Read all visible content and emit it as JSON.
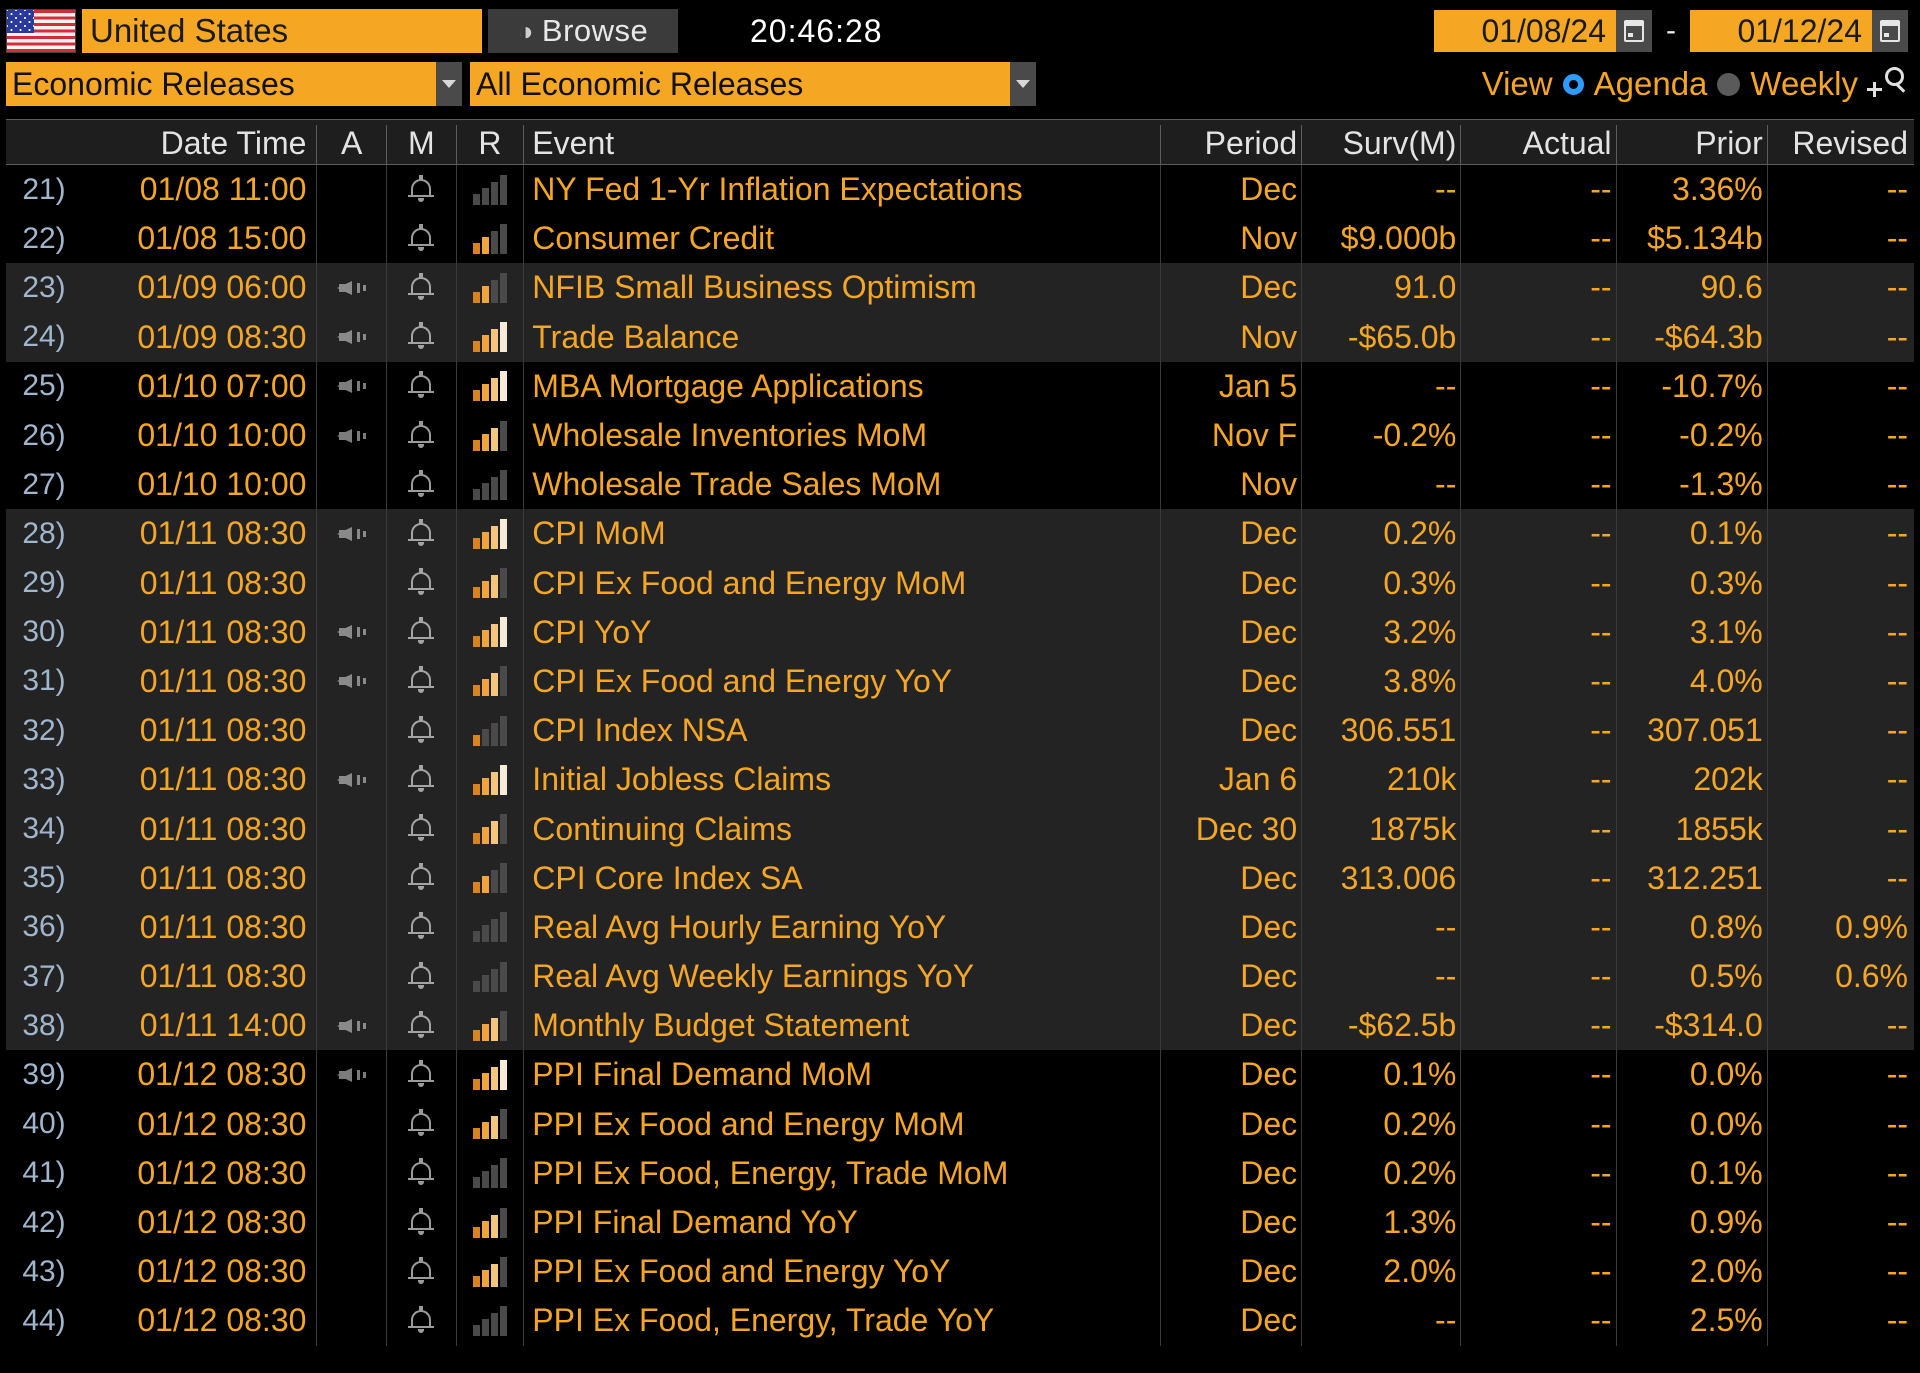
{
  "header": {
    "flag_icon": "us-flag-icon",
    "ticker_value": "United States",
    "browse_label": "Browse",
    "browse_glyph": "◑",
    "clock": "20:46:28",
    "date_from": "01/08/24",
    "date_to": "01/12/24",
    "date_sep": "-",
    "calendar_icon": "calendar-icon",
    "category_value": "Economic Releases",
    "subcategory_value": "All Economic Releases",
    "view_label": "View",
    "view_options": [
      "Agenda",
      "Weekly"
    ],
    "view_selected": "Agenda",
    "search_icon": "add-search-icon",
    "accent_orange": "#f5a623",
    "accent_blue": "#2e9bff"
  },
  "table": {
    "columns": [
      "Date Time",
      "A",
      "M",
      "R",
      "Event",
      "Period",
      "Surv(M)",
      "Actual",
      "Prior",
      "Revised"
    ],
    "rows": [
      {
        "num": "21)",
        "date": "01/08 11:00",
        "audio": false,
        "alert": true,
        "relevance": 0,
        "event": "NY Fed 1-Yr Inflation Expectations",
        "period": "Dec",
        "surv": "--",
        "actual": "--",
        "prior": "3.36%",
        "revised": "--",
        "group": 0
      },
      {
        "num": "22)",
        "date": "01/08 15:00",
        "audio": false,
        "alert": true,
        "relevance": 2,
        "event": "Consumer Credit",
        "period": "Nov",
        "surv": "$9.000b",
        "actual": "--",
        "prior": "$5.134b",
        "revised": "--",
        "group": 0
      },
      {
        "num": "23)",
        "date": "01/09 06:00",
        "audio": true,
        "alert": true,
        "relevance": 2,
        "event": "NFIB Small Business Optimism",
        "period": "Dec",
        "surv": "91.0",
        "actual": "--",
        "prior": "90.6",
        "revised": "--",
        "group": 1
      },
      {
        "num": "24)",
        "date": "01/09 08:30",
        "audio": true,
        "alert": true,
        "relevance": 4,
        "event": "Trade Balance",
        "period": "Nov",
        "surv": "-$65.0b",
        "actual": "--",
        "prior": "-$64.3b",
        "revised": "--",
        "group": 1
      },
      {
        "num": "25)",
        "date": "01/10 07:00",
        "audio": true,
        "alert": true,
        "relevance": 4,
        "event": "MBA Mortgage Applications",
        "period": "Jan 5",
        "surv": "--",
        "actual": "--",
        "prior": "-10.7%",
        "revised": "--",
        "group": 2
      },
      {
        "num": "26)",
        "date": "01/10 10:00",
        "audio": true,
        "alert": true,
        "relevance": 3,
        "event": "Wholesale Inventories MoM",
        "period": "Nov F",
        "surv": "-0.2%",
        "actual": "--",
        "prior": "-0.2%",
        "revised": "--",
        "group": 2
      },
      {
        "num": "27)",
        "date": "01/10 10:00",
        "audio": false,
        "alert": true,
        "relevance": 0,
        "event": "Wholesale Trade Sales MoM",
        "period": "Nov",
        "surv": "--",
        "actual": "--",
        "prior": "-1.3%",
        "revised": "--",
        "group": 2
      },
      {
        "num": "28)",
        "date": "01/11 08:30",
        "audio": true,
        "alert": true,
        "relevance": 4,
        "event": "CPI MoM",
        "period": "Dec",
        "surv": "0.2%",
        "actual": "--",
        "prior": "0.1%",
        "revised": "--",
        "group": 3
      },
      {
        "num": "29)",
        "date": "01/11 08:30",
        "audio": false,
        "alert": true,
        "relevance": 3,
        "event": "CPI Ex Food and Energy MoM",
        "period": "Dec",
        "surv": "0.3%",
        "actual": "--",
        "prior": "0.3%",
        "revised": "--",
        "group": 3
      },
      {
        "num": "30)",
        "date": "01/11 08:30",
        "audio": true,
        "alert": true,
        "relevance": 4,
        "event": "CPI YoY",
        "period": "Dec",
        "surv": "3.2%",
        "actual": "--",
        "prior": "3.1%",
        "revised": "--",
        "group": 3
      },
      {
        "num": "31)",
        "date": "01/11 08:30",
        "audio": true,
        "alert": true,
        "relevance": 3,
        "event": "CPI Ex Food and Energy YoY",
        "period": "Dec",
        "surv": "3.8%",
        "actual": "--",
        "prior": "4.0%",
        "revised": "--",
        "group": 3
      },
      {
        "num": "32)",
        "date": "01/11 08:30",
        "audio": false,
        "alert": true,
        "relevance": 1,
        "event": "CPI Index NSA",
        "period": "Dec",
        "surv": "306.551",
        "actual": "--",
        "prior": "307.051",
        "revised": "--",
        "group": 3
      },
      {
        "num": "33)",
        "date": "01/11 08:30",
        "audio": true,
        "alert": true,
        "relevance": 4,
        "event": "Initial Jobless Claims",
        "period": "Jan 6",
        "surv": "210k",
        "actual": "--",
        "prior": "202k",
        "revised": "--",
        "group": 3
      },
      {
        "num": "34)",
        "date": "01/11 08:30",
        "audio": false,
        "alert": true,
        "relevance": 3,
        "event": "Continuing Claims",
        "period": "Dec 30",
        "surv": "1875k",
        "actual": "--",
        "prior": "1855k",
        "revised": "--",
        "group": 3
      },
      {
        "num": "35)",
        "date": "01/11 08:30",
        "audio": false,
        "alert": true,
        "relevance": 2,
        "event": "CPI Core Index SA",
        "period": "Dec",
        "surv": "313.006",
        "actual": "--",
        "prior": "312.251",
        "revised": "--",
        "group": 3
      },
      {
        "num": "36)",
        "date": "01/11 08:30",
        "audio": false,
        "alert": true,
        "relevance": 0,
        "event": "Real Avg Hourly Earning YoY",
        "period": "Dec",
        "surv": "--",
        "actual": "--",
        "prior": "0.8%",
        "revised": "0.9%",
        "group": 3
      },
      {
        "num": "37)",
        "date": "01/11 08:30",
        "audio": false,
        "alert": true,
        "relevance": 0,
        "event": "Real Avg Weekly Earnings YoY",
        "period": "Dec",
        "surv": "--",
        "actual": "--",
        "prior": "0.5%",
        "revised": "0.6%",
        "group": 3
      },
      {
        "num": "38)",
        "date": "01/11 14:00",
        "audio": true,
        "alert": true,
        "relevance": 3,
        "event": "Monthly Budget Statement",
        "period": "Dec",
        "surv": "-$62.5b",
        "actual": "--",
        "prior": "-$314.0",
        "revised": "--",
        "group": 3
      },
      {
        "num": "39)",
        "date": "01/12 08:30",
        "audio": true,
        "alert": true,
        "relevance": 4,
        "event": "PPI Final Demand MoM",
        "period": "Dec",
        "surv": "0.1%",
        "actual": "--",
        "prior": "0.0%",
        "revised": "--",
        "group": 4
      },
      {
        "num": "40)",
        "date": "01/12 08:30",
        "audio": false,
        "alert": true,
        "relevance": 3,
        "event": "PPI Ex Food and Energy MoM",
        "period": "Dec",
        "surv": "0.2%",
        "actual": "--",
        "prior": "0.0%",
        "revised": "--",
        "group": 4
      },
      {
        "num": "41)",
        "date": "01/12 08:30",
        "audio": false,
        "alert": true,
        "relevance": 0,
        "event": "PPI Ex Food, Energy, Trade MoM",
        "period": "Dec",
        "surv": "0.2%",
        "actual": "--",
        "prior": "0.1%",
        "revised": "--",
        "group": 4
      },
      {
        "num": "42)",
        "date": "01/12 08:30",
        "audio": false,
        "alert": true,
        "relevance": 3,
        "event": "PPI Final Demand YoY",
        "period": "Dec",
        "surv": "1.3%",
        "actual": "--",
        "prior": "0.9%",
        "revised": "--",
        "group": 4
      },
      {
        "num": "43)",
        "date": "01/12 08:30",
        "audio": false,
        "alert": true,
        "relevance": 3,
        "event": "PPI Ex Food and Energy YoY",
        "period": "Dec",
        "surv": "2.0%",
        "actual": "--",
        "prior": "2.0%",
        "revised": "--",
        "group": 4
      },
      {
        "num": "44)",
        "date": "01/12 08:30",
        "audio": false,
        "alert": true,
        "relevance": 0,
        "event": "PPI Ex Food, Energy, Trade YoY",
        "period": "Dec",
        "surv": "--",
        "actual": "--",
        "prior": "2.5%",
        "revised": "--",
        "group": 4
      }
    ]
  }
}
